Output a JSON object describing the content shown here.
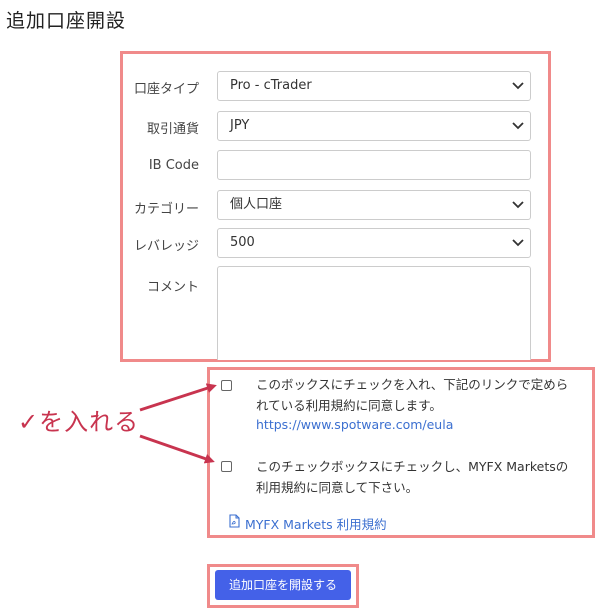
{
  "page": {
    "title": "追加口座開設"
  },
  "form": {
    "account_type": {
      "label": "口座タイプ",
      "value": "Pro - cTrader"
    },
    "currency": {
      "label": "取引通貨",
      "value": "JPY"
    },
    "ib_code": {
      "label": "IB Code",
      "value": ""
    },
    "category": {
      "label": "カテゴリー",
      "value": "個人口座"
    },
    "leverage": {
      "label": "レバレッジ",
      "value": "500"
    },
    "comment": {
      "label": "コメント",
      "value": ""
    }
  },
  "agreements": {
    "first_line1": "このボックスにチェックを入れ、下記のリンクで定めら",
    "first_line2": "れている利用規約に同意します。",
    "first_link": "https://www.spotware.com/eula",
    "second_line1": "このチェックボックスにチェックし、MYFX Marketsの",
    "second_line2": "利用規約に同意して下さい。",
    "terms_link": "MYFX Markets 利用規約"
  },
  "submit": {
    "label": "追加口座を開設する"
  },
  "annotation": {
    "text": "✓を入れる"
  },
  "colors": {
    "highlight_border": "#f08a8a",
    "annotation": "#c8344f",
    "button": "#4461e8",
    "link": "#3b6fd0"
  }
}
